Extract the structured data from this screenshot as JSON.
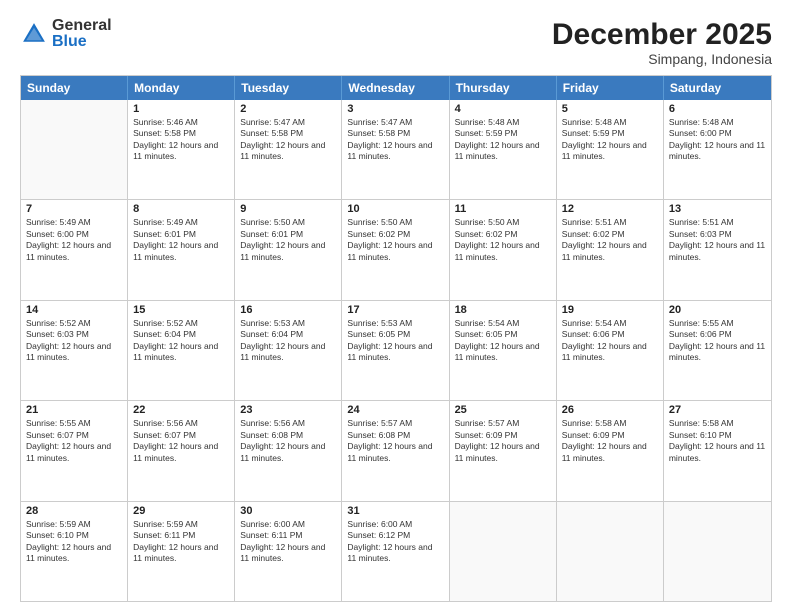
{
  "logo": {
    "general": "General",
    "blue": "Blue"
  },
  "title": "December 2025",
  "location": "Simpang, Indonesia",
  "days": [
    "Sunday",
    "Monday",
    "Tuesday",
    "Wednesday",
    "Thursday",
    "Friday",
    "Saturday"
  ],
  "weeks": [
    [
      {
        "day": "",
        "empty": true
      },
      {
        "day": "1",
        "sunrise": "5:46 AM",
        "sunset": "5:58 PM",
        "daylight": "Daylight: 12 hours and 11 minutes."
      },
      {
        "day": "2",
        "sunrise": "5:47 AM",
        "sunset": "5:58 PM",
        "daylight": "Daylight: 12 hours and 11 minutes."
      },
      {
        "day": "3",
        "sunrise": "5:47 AM",
        "sunset": "5:58 PM",
        "daylight": "Daylight: 12 hours and 11 minutes."
      },
      {
        "day": "4",
        "sunrise": "5:48 AM",
        "sunset": "5:59 PM",
        "daylight": "Daylight: 12 hours and 11 minutes."
      },
      {
        "day": "5",
        "sunrise": "5:48 AM",
        "sunset": "5:59 PM",
        "daylight": "Daylight: 12 hours and 11 minutes."
      },
      {
        "day": "6",
        "sunrise": "5:48 AM",
        "sunset": "6:00 PM",
        "daylight": "Daylight: 12 hours and 11 minutes."
      }
    ],
    [
      {
        "day": "7",
        "sunrise": "5:49 AM",
        "sunset": "6:00 PM",
        "daylight": "Daylight: 12 hours and 11 minutes."
      },
      {
        "day": "8",
        "sunrise": "5:49 AM",
        "sunset": "6:01 PM",
        "daylight": "Daylight: 12 hours and 11 minutes."
      },
      {
        "day": "9",
        "sunrise": "5:50 AM",
        "sunset": "6:01 PM",
        "daylight": "Daylight: 12 hours and 11 minutes."
      },
      {
        "day": "10",
        "sunrise": "5:50 AM",
        "sunset": "6:02 PM",
        "daylight": "Daylight: 12 hours and 11 minutes."
      },
      {
        "day": "11",
        "sunrise": "5:50 AM",
        "sunset": "6:02 PM",
        "daylight": "Daylight: 12 hours and 11 minutes."
      },
      {
        "day": "12",
        "sunrise": "5:51 AM",
        "sunset": "6:02 PM",
        "daylight": "Daylight: 12 hours and 11 minutes."
      },
      {
        "day": "13",
        "sunrise": "5:51 AM",
        "sunset": "6:03 PM",
        "daylight": "Daylight: 12 hours and 11 minutes."
      }
    ],
    [
      {
        "day": "14",
        "sunrise": "5:52 AM",
        "sunset": "6:03 PM",
        "daylight": "Daylight: 12 hours and 11 minutes."
      },
      {
        "day": "15",
        "sunrise": "5:52 AM",
        "sunset": "6:04 PM",
        "daylight": "Daylight: 12 hours and 11 minutes."
      },
      {
        "day": "16",
        "sunrise": "5:53 AM",
        "sunset": "6:04 PM",
        "daylight": "Daylight: 12 hours and 11 minutes."
      },
      {
        "day": "17",
        "sunrise": "5:53 AM",
        "sunset": "6:05 PM",
        "daylight": "Daylight: 12 hours and 11 minutes."
      },
      {
        "day": "18",
        "sunrise": "5:54 AM",
        "sunset": "6:05 PM",
        "daylight": "Daylight: 12 hours and 11 minutes."
      },
      {
        "day": "19",
        "sunrise": "5:54 AM",
        "sunset": "6:06 PM",
        "daylight": "Daylight: 12 hours and 11 minutes."
      },
      {
        "day": "20",
        "sunrise": "5:55 AM",
        "sunset": "6:06 PM",
        "daylight": "Daylight: 12 hours and 11 minutes."
      }
    ],
    [
      {
        "day": "21",
        "sunrise": "5:55 AM",
        "sunset": "6:07 PM",
        "daylight": "Daylight: 12 hours and 11 minutes."
      },
      {
        "day": "22",
        "sunrise": "5:56 AM",
        "sunset": "6:07 PM",
        "daylight": "Daylight: 12 hours and 11 minutes."
      },
      {
        "day": "23",
        "sunrise": "5:56 AM",
        "sunset": "6:08 PM",
        "daylight": "Daylight: 12 hours and 11 minutes."
      },
      {
        "day": "24",
        "sunrise": "5:57 AM",
        "sunset": "6:08 PM",
        "daylight": "Daylight: 12 hours and 11 minutes."
      },
      {
        "day": "25",
        "sunrise": "5:57 AM",
        "sunset": "6:09 PM",
        "daylight": "Daylight: 12 hours and 11 minutes."
      },
      {
        "day": "26",
        "sunrise": "5:58 AM",
        "sunset": "6:09 PM",
        "daylight": "Daylight: 12 hours and 11 minutes."
      },
      {
        "day": "27",
        "sunrise": "5:58 AM",
        "sunset": "6:10 PM",
        "daylight": "Daylight: 12 hours and 11 minutes."
      }
    ],
    [
      {
        "day": "28",
        "sunrise": "5:59 AM",
        "sunset": "6:10 PM",
        "daylight": "Daylight: 12 hours and 11 minutes."
      },
      {
        "day": "29",
        "sunrise": "5:59 AM",
        "sunset": "6:11 PM",
        "daylight": "Daylight: 12 hours and 11 minutes."
      },
      {
        "day": "30",
        "sunrise": "6:00 AM",
        "sunset": "6:11 PM",
        "daylight": "Daylight: 12 hours and 11 minutes."
      },
      {
        "day": "31",
        "sunrise": "6:00 AM",
        "sunset": "6:12 PM",
        "daylight": "Daylight: 12 hours and 11 minutes."
      },
      {
        "day": "",
        "empty": true
      },
      {
        "day": "",
        "empty": true
      },
      {
        "day": "",
        "empty": true
      }
    ]
  ]
}
